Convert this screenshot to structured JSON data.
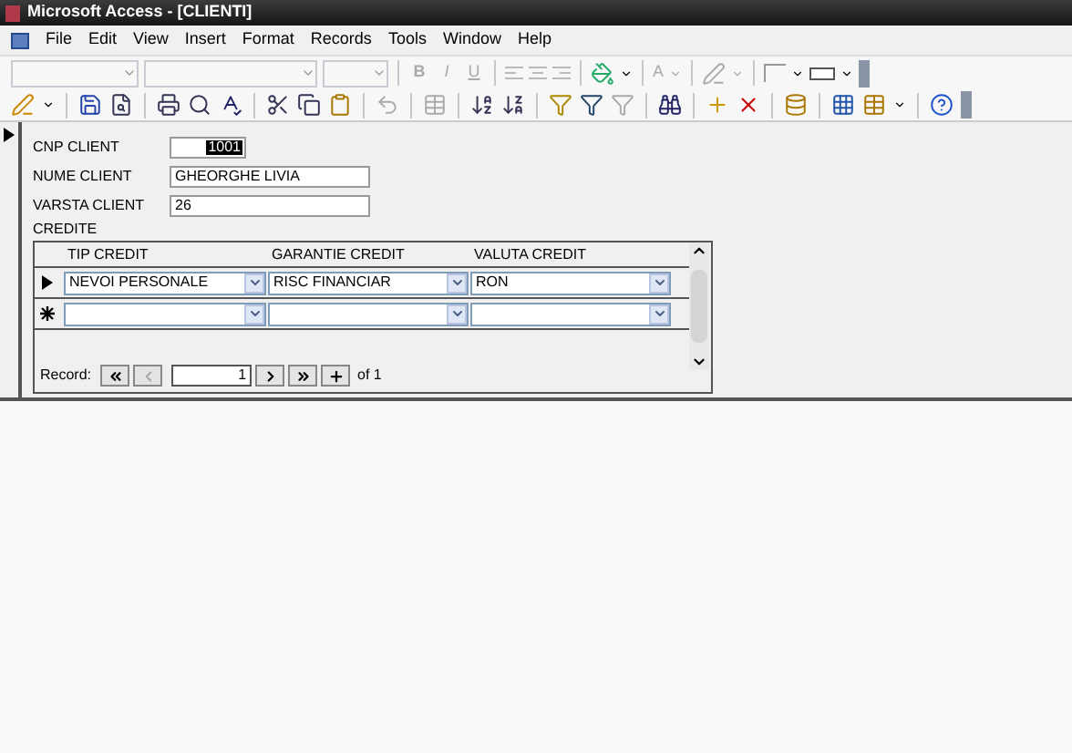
{
  "window": {
    "title": "Microsoft Access - [CLIENTI]"
  },
  "menu": [
    {
      "label": "File"
    },
    {
      "label": "Edit"
    },
    {
      "label": "View"
    },
    {
      "label": "Insert"
    },
    {
      "label": "Format"
    },
    {
      "label": "Records"
    },
    {
      "label": "Tools"
    },
    {
      "label": "Window"
    },
    {
      "label": "Help"
    }
  ],
  "formatting_toolbar": {
    "style_buttons": [
      "B",
      "I",
      "U"
    ],
    "font_color_letter": "A"
  },
  "form": {
    "fields": [
      {
        "label": "CNP CLIENT",
        "value": "1001",
        "selected": true
      },
      {
        "label": "NUME CLIENT",
        "value": "GHEORGHE LIVIA",
        "selected": false
      },
      {
        "label": "VARSTA CLIENT",
        "value": "26",
        "selected": false
      }
    ],
    "subform_label": "CREDITE",
    "subform": {
      "columns": [
        "TIP CREDIT",
        "GARANTIE CREDIT",
        "VALUTA CREDIT"
      ],
      "rows": [
        {
          "kind": "current",
          "cells": [
            "NEVOI PERSONALE",
            "RISC FINANCIAR",
            "RON"
          ]
        },
        {
          "kind": "new",
          "cells": []
        }
      ],
      "navigation": {
        "label": "Record:",
        "current": "1",
        "total": "of 1"
      }
    }
  }
}
